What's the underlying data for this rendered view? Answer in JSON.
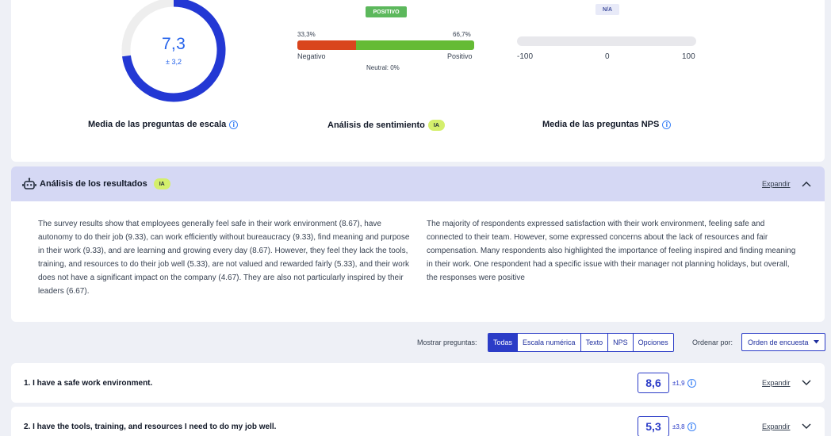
{
  "metrics": {
    "scale": {
      "value": "7,3",
      "std": "± 3,2",
      "fill_fraction": 0.73,
      "label": "Media de las preguntas de escala"
    },
    "sentiment": {
      "badge": "POSITIVO",
      "negative_pct": "33,3%",
      "positive_pct": "66,7%",
      "negative_fraction": 0.333,
      "negative_label": "Negativo",
      "positive_label": "Positivo",
      "neutral": "Neutral: 0%",
      "label": "Análisis de sentimiento",
      "ia_badge": "IA"
    },
    "nps": {
      "badge": "N/A",
      "ticks": [
        "-100",
        "0",
        "100"
      ],
      "label": "Media de las preguntas NPS"
    }
  },
  "analysis": {
    "title": "Análisis de los resultados",
    "ia_badge": "IA",
    "expand_label": "Expandir",
    "left_text": "The survey results show that employees generally feel safe in their work environment (8.67), have autonomy to do their job (9.33), can work efficiently without bureaucracy (9.33), find meaning and purpose in their work (9.33), and are learning and growing every day (8.67). However, they feel they lack the tools, training, and resources to do their job well (5.33), are not valued and rewarded fairly (5.33), and their work does not have a significant impact on the company (4.67). They are also not particularly inspired by their leaders (6.67).",
    "right_text": "The majority of respondents expressed satisfaction with their work environment, feeling safe and connected to their team. However, some expressed concerns about the lack of resources and fair compensation. Many respondents also highlighted the importance of feeling inspired and finding meaning in their work. One respondent had a specific issue with their manager not planning holidays, but overall, the responses were positive"
  },
  "filters": {
    "show_label": "Mostrar preguntas:",
    "options": [
      "Todas",
      "Escala numérica",
      "Texto",
      "NPS",
      "Opciones"
    ],
    "order_label": "Ordenar por:",
    "order_value": "Orden de encuesta"
  },
  "questions": [
    {
      "text": "1. I have a safe work environment.",
      "score": "8,6",
      "std": "±1,9",
      "expand_label": "Expandir"
    },
    {
      "text": "2. I have the tools, training, and resources I need to do my job well.",
      "score": "5,3",
      "std": "±3,8",
      "expand_label": "Expandir"
    }
  ],
  "colors": {
    "accent": "#2b3cc7",
    "gauge": "#2338d4",
    "negative": "#d9451d",
    "positive": "#65bb35",
    "ia_badge": "#d4ef6c"
  }
}
